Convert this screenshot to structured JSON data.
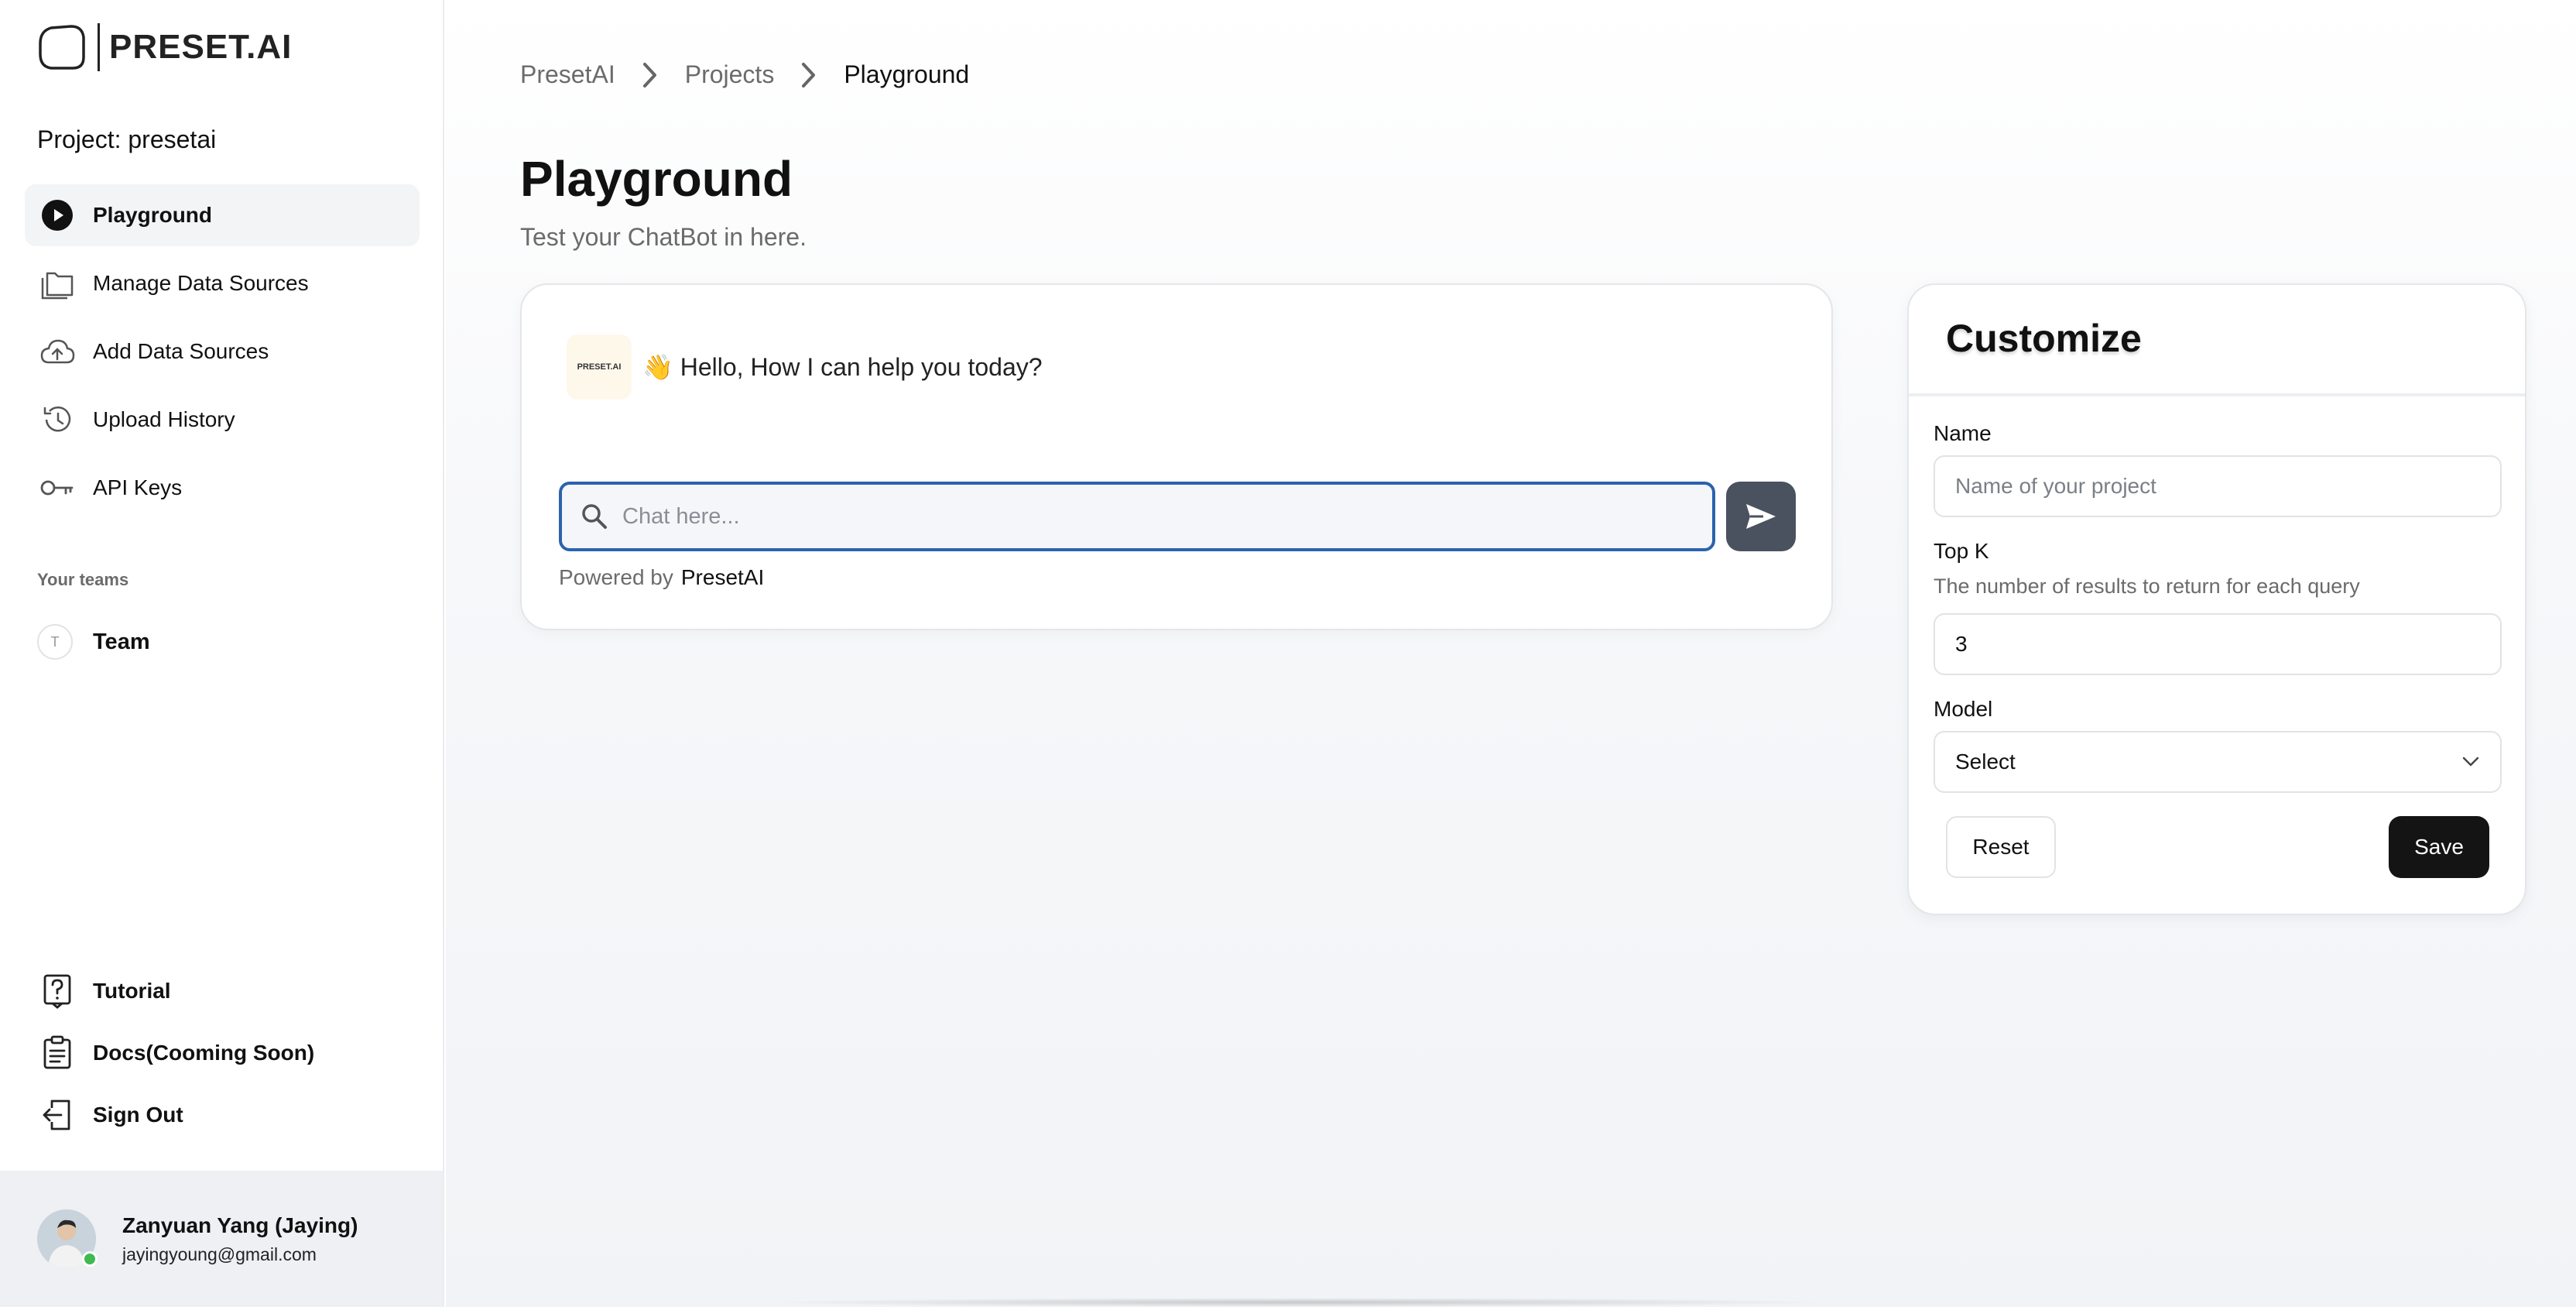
{
  "brand": {
    "logo_text": "PRESET.AI"
  },
  "sidebar": {
    "project_label": "Project: presetai",
    "items": [
      {
        "label": "Playground",
        "icon": "play-circle-icon",
        "active": true
      },
      {
        "label": "Manage Data Sources",
        "icon": "folders-icon"
      },
      {
        "label": "Add Data Sources",
        "icon": "cloud-upload-icon"
      },
      {
        "label": "Upload History",
        "icon": "history-icon"
      },
      {
        "label": "API Keys",
        "icon": "key-icon"
      }
    ],
    "teams_title": "Your teams",
    "team": {
      "initial": "T",
      "label": "Team"
    },
    "bottom_items": [
      {
        "label": "Tutorial",
        "icon": "question-icon"
      },
      {
        "label": "Docs(Cooming Soon)",
        "icon": "clipboard-icon"
      },
      {
        "label": "Sign Out",
        "icon": "sign-out-icon"
      }
    ],
    "user": {
      "name": "Zanyuan Yang (Jaying)",
      "email": "jayingyoung@gmail.com"
    }
  },
  "breadcrumb": [
    "PresetAI",
    "Projects",
    "Playground"
  ],
  "page": {
    "title": "Playground",
    "subtitle": "Test your ChatBot in here."
  },
  "chat": {
    "bot_avatar_text": "PRESET.AI",
    "greeting": "👋 Hello, How I can help you today?",
    "input_placeholder": "Chat here...",
    "powered_by": "Powered by",
    "powered_brand": "PresetAI"
  },
  "customize": {
    "title": "Customize",
    "name_label": "Name",
    "name_placeholder": "Name of your project",
    "topk_label": "Top K",
    "topk_help": "The number of results to return for each query",
    "topk_value": "3",
    "model_label": "Model",
    "model_value": "Select",
    "reset_label": "Reset",
    "save_label": "Save"
  },
  "colors": {
    "accent": "#2b63ad",
    "send_button": "#4a5260",
    "save_button": "#141414",
    "online": "#3fb950"
  }
}
